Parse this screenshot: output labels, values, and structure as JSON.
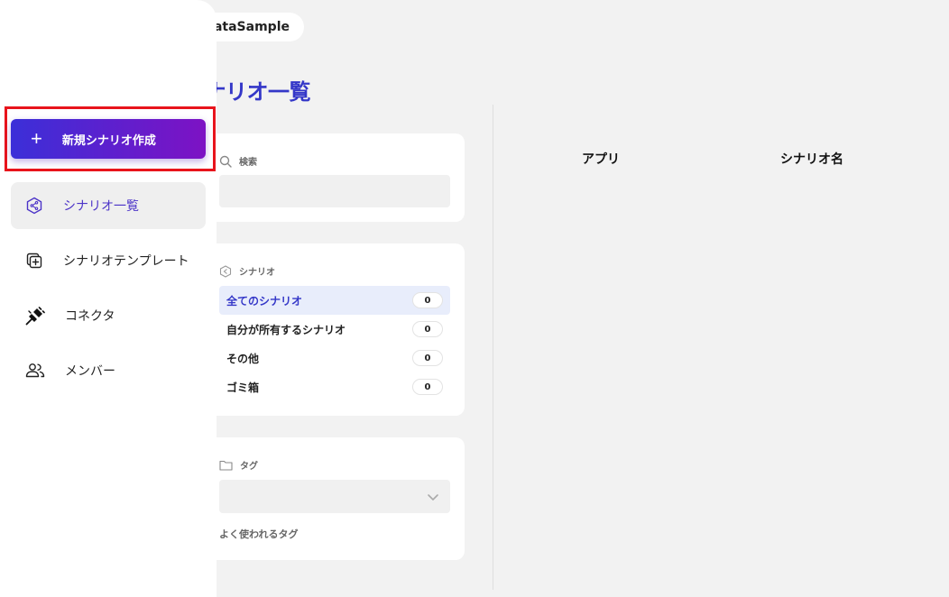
{
  "workspace": {
    "name": "DataSample"
  },
  "page": {
    "title": "シナリオ一覧"
  },
  "sidebar": {
    "new_button_label": "新規シナリオ作成",
    "items": [
      {
        "label": "シナリオ一覧",
        "icon": "scenario-icon",
        "active": true
      },
      {
        "label": "シナリオテンプレート",
        "icon": "template-icon",
        "active": false
      },
      {
        "label": "コネクタ",
        "icon": "plug-icon",
        "active": false
      },
      {
        "label": "メンバー",
        "icon": "members-icon",
        "active": false
      }
    ]
  },
  "search": {
    "label": "検索",
    "placeholder": ""
  },
  "scenario_filter": {
    "label": "シナリオ",
    "items": [
      {
        "label": "全てのシナリオ",
        "count": "0",
        "active": true
      },
      {
        "label": "自分が所有するシナリオ",
        "count": "0",
        "active": false
      },
      {
        "label": "その他",
        "count": "0",
        "active": false
      },
      {
        "label": "ゴミ箱",
        "count": "0",
        "active": false
      }
    ]
  },
  "tag_filter": {
    "label": "タグ",
    "selected": "",
    "frequent_label": "よく使われるタグ"
  },
  "table": {
    "columns": [
      "アプリ",
      "シナリオ名"
    ]
  },
  "colors": {
    "accent": "#3437c8",
    "gradient_start": "#3b2fd8",
    "gradient_end": "#7d12c4",
    "highlight_outline": "#e8141c"
  }
}
